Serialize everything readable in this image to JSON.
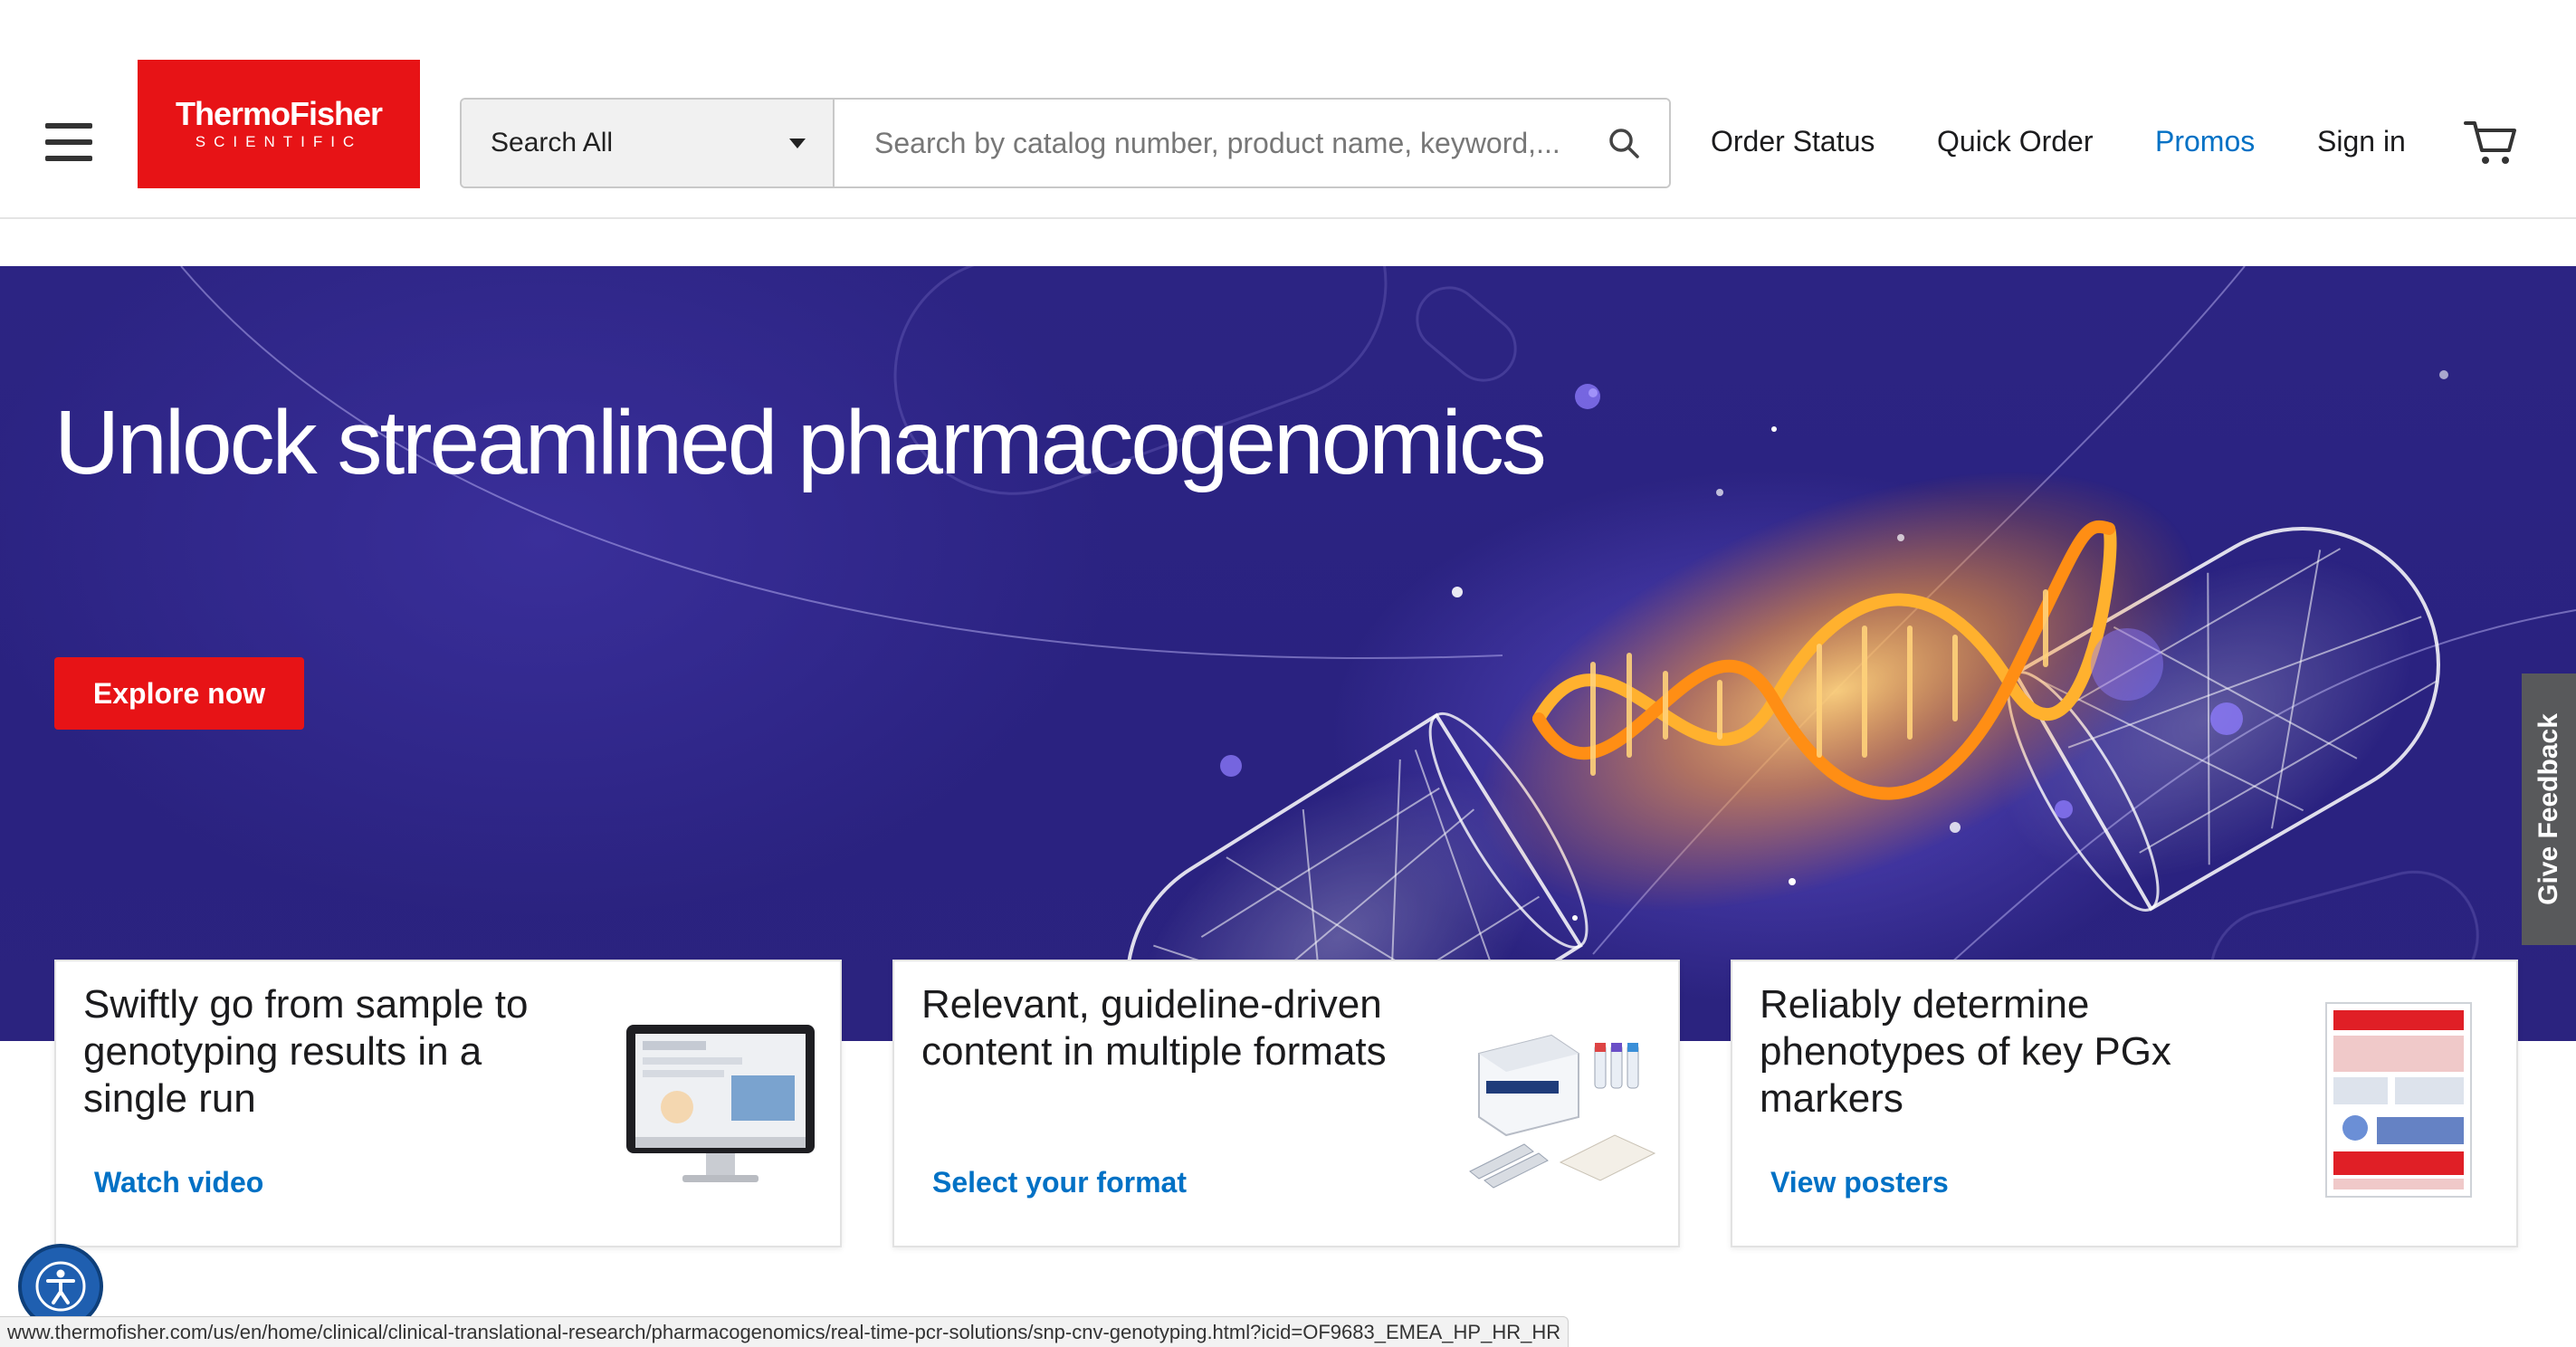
{
  "header": {
    "logo_line1": "ThermoFisher",
    "logo_line2": "SCIENTIFIC",
    "search_category": "Search All",
    "search_placeholder": "Search by catalog number, product name, keyword,...",
    "nav": {
      "order_status": "Order Status",
      "quick_order": "Quick Order",
      "promos": "Promos",
      "sign_in": "Sign in"
    }
  },
  "hero": {
    "title": "Unlock streamlined pharmacogenomics",
    "cta": "Explore now"
  },
  "feedback": "Give Feedback",
  "cards": [
    {
      "title": "Swiftly go from sample to genotyping results in a single run",
      "link": "Watch video"
    },
    {
      "title": "Relevant, guideline-driven content in multiple formats",
      "link": "Select your format"
    },
    {
      "title": "Reliably determine phenotypes of key PGx markers",
      "link": "View posters"
    }
  ],
  "status_url": "www.thermofisher.com/us/en/home/clinical/clinical-translational-research/pharmacogenomics/real-time-pcr-solutions/snp-cnv-genotyping.html?icid=OF9683_EMEA_HP_HR_HR",
  "colors": {
    "brand_red": "#e71316",
    "link_blue": "#0071c5",
    "hero_bg": "#2c2483"
  },
  "icons": [
    "hamburger-menu-icon",
    "search-icon",
    "cart-icon",
    "accessibility-icon"
  ]
}
